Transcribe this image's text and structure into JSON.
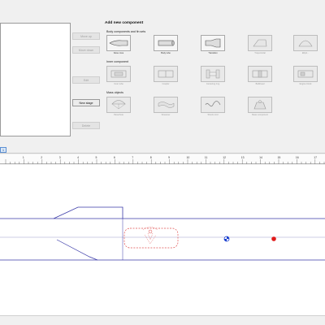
{
  "stage_buttons": {
    "move_up": "Move up",
    "move_down": "Move down",
    "edit": "Edit",
    "new_stage": "New stage",
    "delete": "Delete"
  },
  "add_component": {
    "title": "Add new component",
    "body_group": "Body components and fin sets",
    "inner_group": "Inner component",
    "mass_group": "Mass objects",
    "body_items": [
      {
        "label": "Nose cone",
        "icon": "nose-cone-icon",
        "enabled": true
      },
      {
        "label": "Body tube",
        "icon": "body-tube-icon",
        "enabled": true
      },
      {
        "label": "Transition",
        "icon": "transition-icon",
        "enabled": true
      },
      {
        "label": "Trapezoidal",
        "icon": "trapezoidal-fin-icon",
        "enabled": false
      },
      {
        "label": "Ellipti...",
        "icon": "elliptical-fin-icon",
        "enabled": false
      }
    ],
    "inner_items": [
      {
        "label": "Inner tube",
        "icon": "inner-tube-icon",
        "enabled": false
      },
      {
        "label": "Coupler",
        "icon": "coupler-icon",
        "enabled": false
      },
      {
        "label": "Centering ring",
        "icon": "centering-ring-icon",
        "enabled": false
      },
      {
        "label": "Bulkhead",
        "icon": "bulkhead-icon",
        "enabled": false
      },
      {
        "label": "Engine block",
        "icon": "engine-block-icon",
        "enabled": false
      }
    ],
    "mass_items": [
      {
        "label": "Parachute",
        "icon": "parachute-icon",
        "enabled": false
      },
      {
        "label": "Streamer",
        "icon": "streamer-icon",
        "enabled": false
      },
      {
        "label": "Shock cord",
        "icon": "shock-cord-icon",
        "enabled": false
      },
      {
        "label": "Mass component",
        "icon": "mass-component-icon",
        "enabled": false
      }
    ]
  },
  "tab": {
    "label": "1"
  },
  "ruler": {
    "labels": [
      "1",
      "2",
      "3",
      "4",
      "5",
      "6",
      "7",
      "8",
      "9",
      "10",
      "11",
      "12",
      "13",
      "14",
      "15",
      "16",
      "17",
      "18"
    ]
  },
  "colors": {
    "outline": "#3a3aa8",
    "recovery": "#e05050",
    "cg_marker": "#1a3fcf",
    "cp_marker": "#e01a1a"
  }
}
